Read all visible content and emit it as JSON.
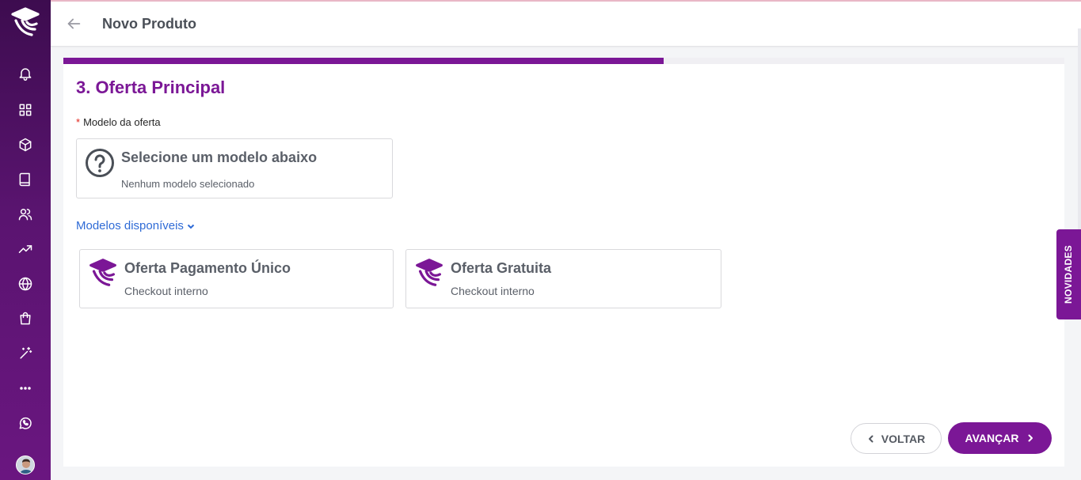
{
  "header": {
    "title": "Novo Produto"
  },
  "sidebar": {
    "items": [
      {
        "icon": "bell-icon"
      },
      {
        "icon": "grid-icon"
      },
      {
        "icon": "box-icon"
      },
      {
        "icon": "book-icon"
      },
      {
        "icon": "users-icon"
      },
      {
        "icon": "trending-up-icon"
      },
      {
        "icon": "globe-icon"
      },
      {
        "icon": "shopping-bag-icon"
      },
      {
        "icon": "magic-wand-icon"
      },
      {
        "icon": "more-icon"
      },
      {
        "icon": "whatsapp-icon"
      }
    ]
  },
  "wizard": {
    "progress_percent": 60,
    "step_title": "3. Oferta Principal",
    "field_label": "Modelo da oferta",
    "required_mark": "*",
    "selected": {
      "title": "Selecione um modelo abaixo",
      "subtitle": "Nenhum modelo selecionado"
    },
    "models_toggle_label": "Modelos disponíveis",
    "models": [
      {
        "title": "Oferta Pagamento Único",
        "subtitle": "Checkout interno"
      },
      {
        "title": "Oferta Gratuita",
        "subtitle": "Checkout interno"
      }
    ],
    "back_label": "VOLTAR",
    "next_label": "AVANÇAR"
  },
  "novidades_label": "NOVIDADES",
  "colors": {
    "accent": "#7b1796",
    "link": "#2f6bd6",
    "sidebar": "#5a1470"
  }
}
